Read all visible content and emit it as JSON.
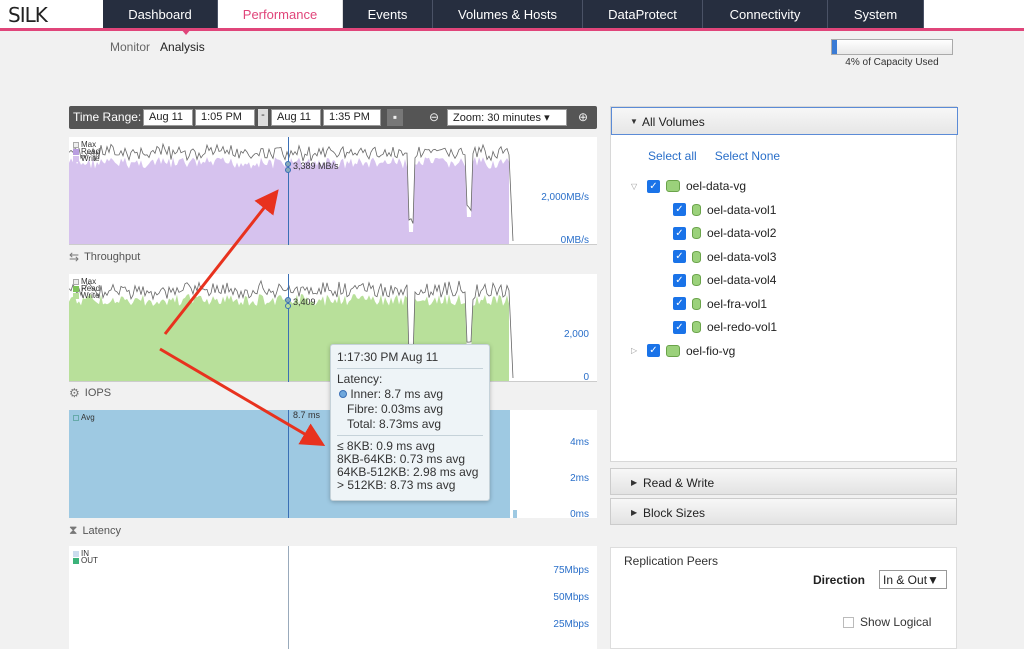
{
  "app": {
    "logo": "SILK"
  },
  "nav": {
    "tabs": [
      {
        "label": "Dashboard",
        "width": 115
      },
      {
        "label": "Performance",
        "width": 125,
        "active": true
      },
      {
        "label": "Events",
        "width": 90
      },
      {
        "label": "Volumes & Hosts",
        "width": 150
      },
      {
        "label": "DataProtect",
        "width": 120
      },
      {
        "label": "Connectivity",
        "width": 125
      },
      {
        "label": "System",
        "width": 96
      }
    ]
  },
  "subnav": {
    "monitor": "Monitor",
    "analysis": "Analysis"
  },
  "capacity": {
    "percent": 4,
    "label": "4% of Capacity Used"
  },
  "toolbar": {
    "label": "Time Range:",
    "start_date": "Aug 11",
    "start_time": "1:05 PM",
    "dash": "-",
    "end_date": "Aug 11",
    "end_time": "1:35 PM",
    "zoom": "Zoom: 30 minutes"
  },
  "charts": {
    "throughput": {
      "title": "Throughput",
      "legend": [
        "Max",
        "Read",
        "Write"
      ],
      "cursor_label": "3,389 MB/s",
      "y_labels": [
        "2,000MB/s",
        "0MB/s"
      ],
      "fill": "#d6c2ee"
    },
    "iops": {
      "title": "IOPS",
      "legend": [
        "Max",
        "Read",
        "Write"
      ],
      "cursor_label": "3,409",
      "y_labels": [
        "2,000",
        "0"
      ],
      "fill": "#b8e09a"
    },
    "latency": {
      "title": "Latency",
      "legend": [
        "Avg"
      ],
      "cursor_label": "8.7 ms",
      "y_labels": [
        "4ms",
        "2ms",
        "0ms"
      ],
      "fill": "#9ec9e2"
    },
    "bandwidth": {
      "legend": [
        "IN",
        "OUT"
      ],
      "y_labels": [
        "75Mbps",
        "50Mbps",
        "25Mbps"
      ]
    }
  },
  "tooltip": {
    "time": "1:17:30 PM Aug 11",
    "latency": "Latency:",
    "inner": "Inner: 8.7 ms avg",
    "fibre": "Fibre: 0.03ms avg",
    "total": "Total: 8.73ms avg",
    "b1": "≤ 8KB: 0.9 ms avg",
    "b2": "8KB-64KB: 0.73 ms avg",
    "b3": "64KB-512KB: 2.98 ms avg",
    "b4": "> 512KB: 8.73 ms avg"
  },
  "volumes_panel": {
    "header": "All Volumes",
    "select_all": "Select all",
    "select_none": "Select None",
    "groups": [
      {
        "name": "oel-data-vg",
        "expanded": true,
        "volumes": [
          "oel-data-vol1",
          "oel-data-vol2",
          "oel-data-vol3",
          "oel-data-vol4",
          "oel-fra-vol1",
          "oel-redo-vol1"
        ]
      },
      {
        "name": "oel-fio-vg",
        "expanded": false,
        "volumes": []
      }
    ]
  },
  "accordions": {
    "read_write": "Read & Write",
    "block_sizes": "Block Sizes"
  },
  "replication": {
    "title": "Replication Peers",
    "direction_label": "Direction",
    "direction_value": "In & Out",
    "show_logical": "Show Logical"
  },
  "colors": {
    "accent": "#e0457a",
    "nav_bg": "#262e3f",
    "link": "#2a6fc9",
    "arrow": "#e8321e"
  }
}
